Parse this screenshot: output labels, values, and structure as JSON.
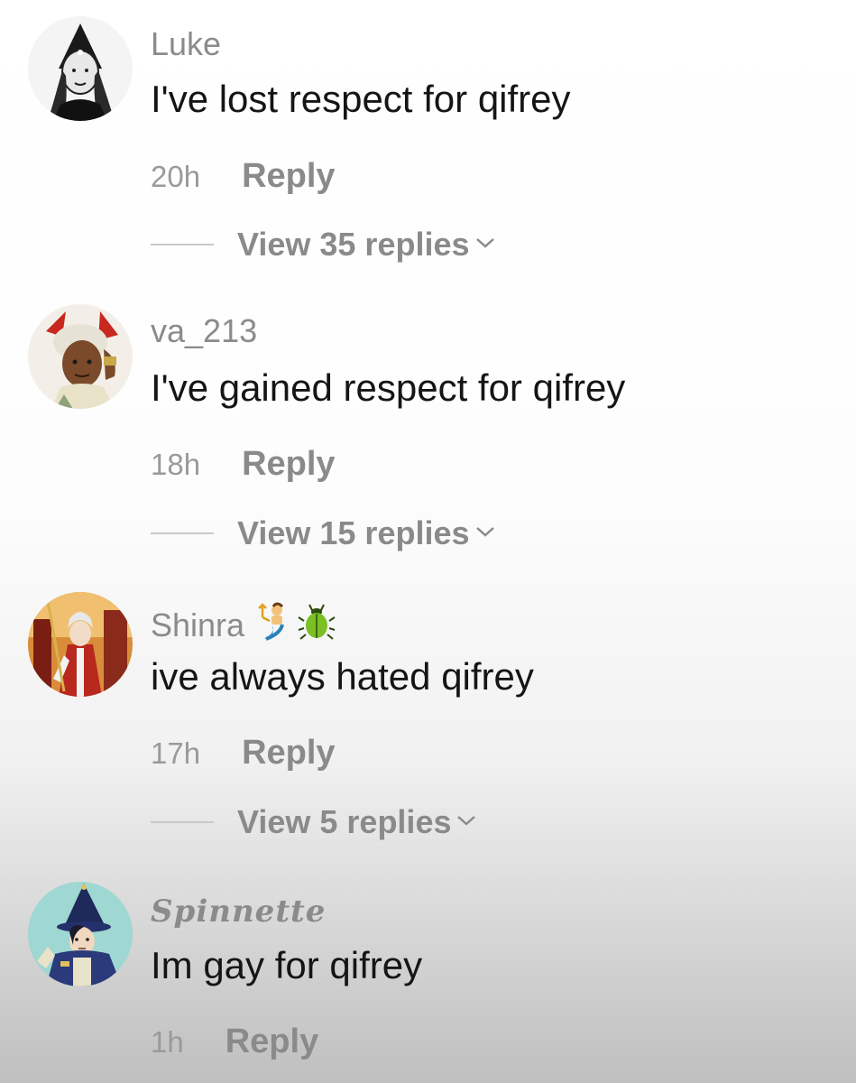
{
  "comments": [
    {
      "username": "Luke",
      "text_prefix": "I've lost respect for ",
      "mention": "qifrey",
      "time": "20h",
      "reply_label": "Reply",
      "view_replies": "View 35 replies",
      "avatar_icon": "hooded-character-avatar"
    },
    {
      "username": "va_213",
      "text_prefix": "I've gained respect for ",
      "mention": "qifrey",
      "time": "18h",
      "reply_label": "Reply",
      "view_replies": "View 15 replies",
      "avatar_icon": "red-haired-character-avatar"
    },
    {
      "username": "Shinra",
      "username_emojis": [
        "merman-emoji",
        "beetle-emoji"
      ],
      "text_prefix": "ive always hated ",
      "mention": "qifrey",
      "time": "17h",
      "reply_label": "Reply",
      "view_replies": "View 5 replies",
      "avatar_icon": "red-armored-character-avatar"
    },
    {
      "username": "Spinnette",
      "text_prefix": "Im gay for ",
      "mention": "qifrey",
      "time": "1h",
      "reply_label": "Reply",
      "avatar_icon": "wizard-hat-character-avatar"
    }
  ],
  "colors": {
    "username": "#8b8b8b",
    "comment_text": "#151515",
    "meta": "#9a9a9a"
  }
}
